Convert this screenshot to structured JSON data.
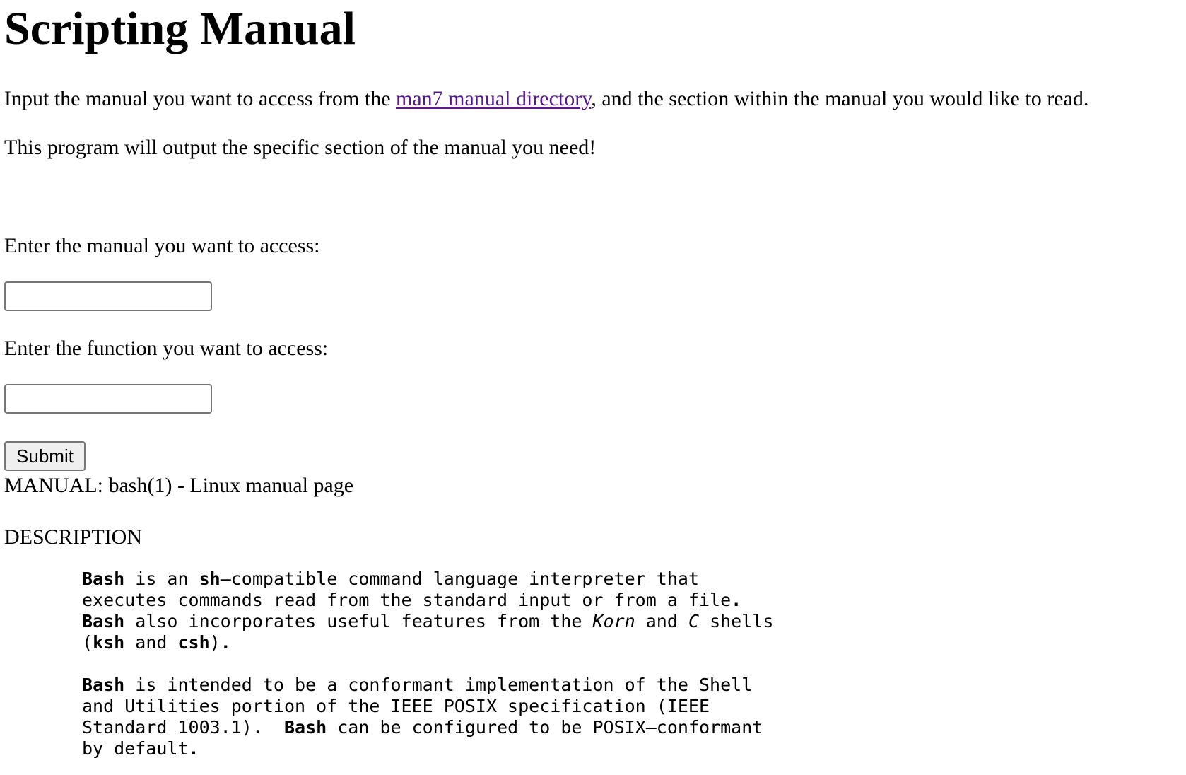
{
  "page": {
    "title": "Scripting Manual",
    "intro_before_link": "Input the manual you want to access from the ",
    "intro_link_text": "man7 manual directory",
    "intro_after_link": ", and the section within the manual you would like to read.",
    "intro_second": "This program will output the specific section of the manual you need!"
  },
  "form": {
    "manual_label": "Enter the manual you want to access:",
    "manual_value": "",
    "function_label": "Enter the function you want to access:",
    "function_value": "",
    "submit_label": "Submit"
  },
  "result": {
    "title": "MANUAL: bash(1) - Linux manual page",
    "section_heading": "DESCRIPTION",
    "para1": {
      "l1_b1": "Bash",
      "l1_t1": " is an ",
      "l1_b2": "sh",
      "l1_t2": "–compatible command language interpreter that",
      "l2_t1": "executes commands read from the standard input or from a file",
      "l2_b1": ".",
      "l3_b1": "Bash",
      "l3_t1": " also incorporates useful features from the ",
      "l3_i1": "Korn",
      "l3_t2": " and ",
      "l3_i2": "C",
      "l3_t3": " shells",
      "l4_t1": "(",
      "l4_b1": "ksh",
      "l4_t2": " and ",
      "l4_b2": "csh",
      "l4_t3": ")",
      "l4_b3": "."
    },
    "para2": {
      "l1_b1": "Bash",
      "l1_t1": " is intended to be a conformant implementation of the Shell",
      "l2_t1": "and Utilities portion of the IEEE POSIX specification (IEEE",
      "l3_t1": "Standard 1003.1).  ",
      "l3_b1": "Bash",
      "l3_t2": " can be configured to be POSIX–conformant",
      "l4_t1": "by default",
      "l4_b1": "."
    }
  }
}
